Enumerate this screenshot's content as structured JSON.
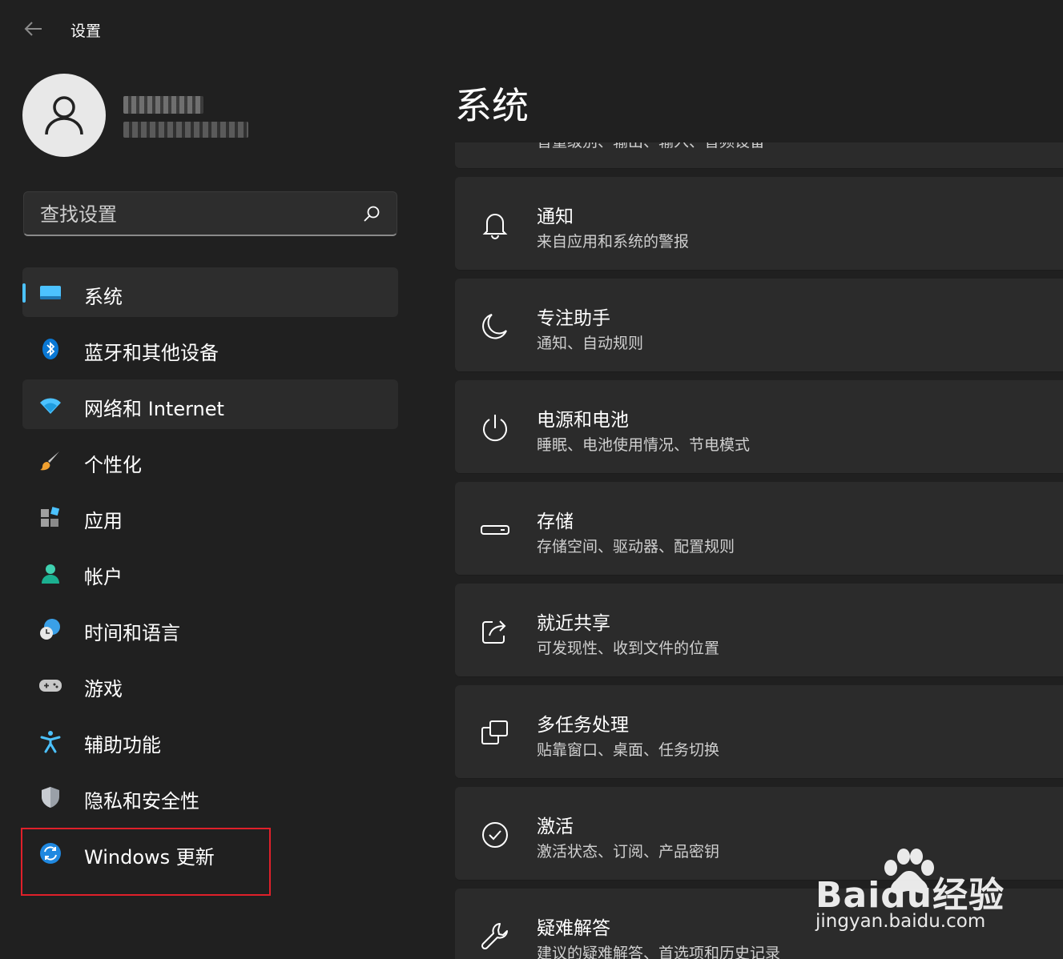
{
  "app": {
    "title": "设置"
  },
  "search": {
    "placeholder": "查找设置"
  },
  "sidebar": {
    "items": [
      {
        "label": "系统",
        "icon": "monitor-icon"
      },
      {
        "label": "蓝牙和其他设备",
        "icon": "bluetooth-icon"
      },
      {
        "label": "网络和 Internet",
        "icon": "wifi-icon"
      },
      {
        "label": "个性化",
        "icon": "paintbrush-icon"
      },
      {
        "label": "应用",
        "icon": "apps-icon"
      },
      {
        "label": "帐户",
        "icon": "person-icon"
      },
      {
        "label": "时间和语言",
        "icon": "globe-clock-icon"
      },
      {
        "label": "游戏",
        "icon": "gamepad-icon"
      },
      {
        "label": "辅助功能",
        "icon": "accessibility-icon"
      },
      {
        "label": "隐私和安全性",
        "icon": "shield-icon"
      },
      {
        "label": "Windows 更新",
        "icon": "windows-update-icon"
      }
    ]
  },
  "main": {
    "title": "系统",
    "partial_card_sub": "音量级别、输出、输入、音频设备",
    "cards": [
      {
        "title": "通知",
        "sub": "来自应用和系统的警报",
        "icon": "bell-icon"
      },
      {
        "title": "专注助手",
        "sub": "通知、自动规则",
        "icon": "moon-icon"
      },
      {
        "title": "电源和电池",
        "sub": "睡眠、电池使用情况、节电模式",
        "icon": "power-icon"
      },
      {
        "title": "存储",
        "sub": "存储空间、驱动器、配置规则",
        "icon": "storage-icon"
      },
      {
        "title": "就近共享",
        "sub": "可发现性、收到文件的位置",
        "icon": "share-icon"
      },
      {
        "title": "多任务处理",
        "sub": "贴靠窗口、桌面、任务切换",
        "icon": "multitask-icon"
      },
      {
        "title": "激活",
        "sub": "激活状态、订阅、产品密钥",
        "icon": "check-circle-icon"
      },
      {
        "title": "疑难解答",
        "sub": "建议的疑难解答、首选项和历史记录",
        "icon": "wrench-icon"
      }
    ]
  },
  "watermark": {
    "brand": "Baidu经验",
    "url": "jingyan.baidu.com"
  },
  "colors": {
    "accent": "#4cc2ff",
    "background": "#202020",
    "card": "#2b2b2b",
    "highlight": "#e0202a"
  }
}
